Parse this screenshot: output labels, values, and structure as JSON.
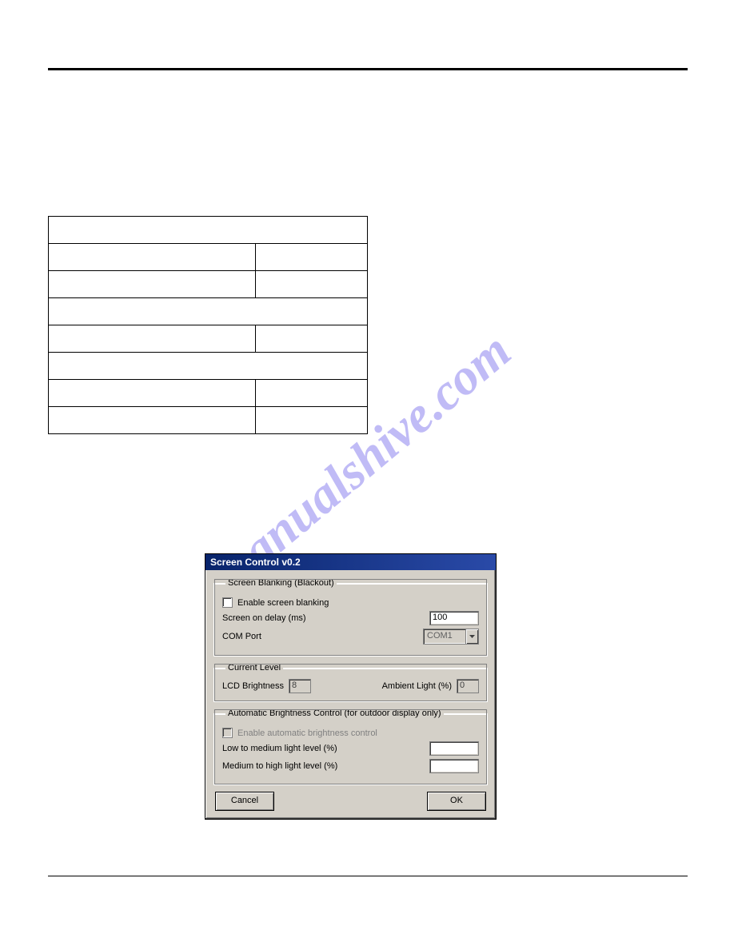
{
  "dialog": {
    "title": "Screen Control v0.2",
    "groups": {
      "blanking": {
        "legend": "Screen Blanking (Blackout)",
        "enable_label": "Enable screen blanking",
        "enable_checked": false,
        "delay_label": "Screen on delay (ms)",
        "delay_value": "100",
        "com_label": "COM Port",
        "com_value": "COM1"
      },
      "current": {
        "legend": "Current Level",
        "lcd_label": "LCD Brightness",
        "lcd_value": "8",
        "ambient_label": "Ambient Light (%)",
        "ambient_value": "0"
      },
      "auto": {
        "legend": "Automatic Brightness Control (for outdoor display only)",
        "enable_label": "Enable automatic brightness control",
        "enable_checked": false,
        "low_label": "Low to medium light level (%)",
        "low_value": "",
        "med_label": "Medium to high light level (%)",
        "med_value": ""
      }
    },
    "buttons": {
      "cancel": "Cancel",
      "ok": "OK"
    }
  },
  "watermark_text": "manualshive.com"
}
